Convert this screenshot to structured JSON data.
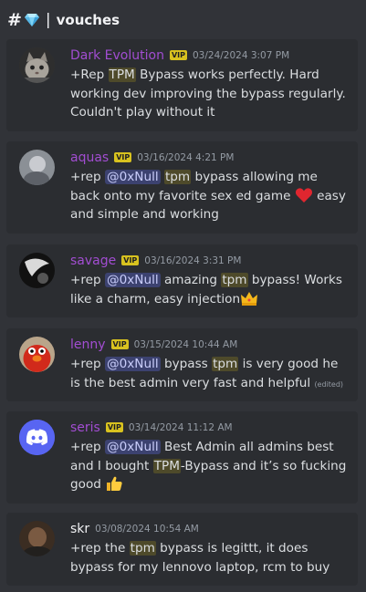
{
  "header": {
    "hash": "#",
    "separator": "|",
    "channel": "vouches",
    "gem_icon": "gem-icon"
  },
  "colors": {
    "bg": "#313338",
    "card": "#2b2d31",
    "username_purple": "#a24dd2",
    "vip": "#d8c21f",
    "mention_bg": "#3c4270"
  },
  "messages": [
    {
      "username": "Dark Evolution",
      "username_color": "#a24dd2",
      "vip": "VIP",
      "timestamp": "03/24/2024 3:07 PM",
      "parts": [
        "+Rep ",
        "TPM",
        " Bypass works perfectly. Hard working dev improving the bypass regularly. Couldn't play without it"
      ]
    },
    {
      "username": "aquas",
      "username_color": "#a24dd2",
      "vip": "VIP",
      "timestamp": "03/16/2024 4:21 PM",
      "parts": [
        "+rep ",
        "@0xNull",
        " ",
        "tpm",
        " bypass allowing me back onto my favorite sex ed game ",
        " easy and simple  and working"
      ]
    },
    {
      "username": "savage",
      "username_color": "#a24dd2",
      "vip": "VIP",
      "timestamp": "03/16/2024 3:31 PM",
      "parts": [
        "+rep ",
        "@0xNull",
        " amazing ",
        "tpm",
        " bypass! Works like a charm, easy injection"
      ]
    },
    {
      "username": "lenny",
      "username_color": "#a24dd2",
      "vip": "VIP",
      "timestamp": "03/15/2024 10:44 AM",
      "parts": [
        "+rep ",
        "@0xNull",
        " bypass ",
        "tpm",
        " is very good he is the best admin very fast and helpful "
      ],
      "edited": "(edited)"
    },
    {
      "username": "seris",
      "username_color": "#a24dd2",
      "vip": "VIP",
      "timestamp": "03/14/2024 11:12 AM",
      "parts": [
        "+rep ",
        "@0xNull",
        " Best Admin all admins best and I bought ",
        "TPM",
        "-Bypass and it’s so fucking good "
      ]
    },
    {
      "username": "skr",
      "username_color": "#f2f3f5",
      "timestamp": "03/08/2024 10:54 AM",
      "parts": [
        "+rep the ",
        "tpm",
        " bypass is legittt, it does bypass for my lennovo laptop, rcm to buy"
      ]
    }
  ]
}
